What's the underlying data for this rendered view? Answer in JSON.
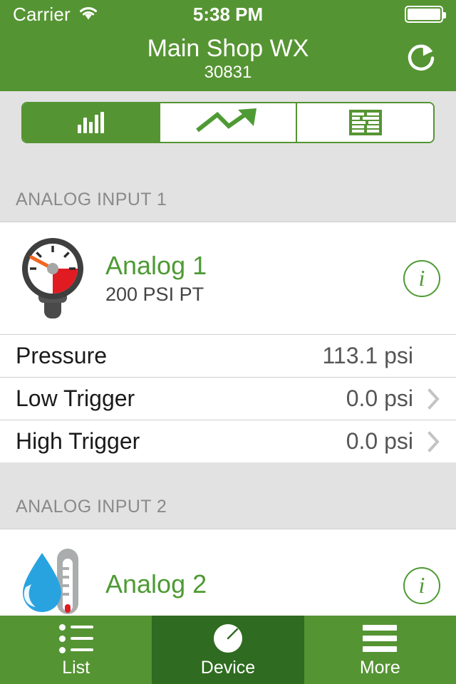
{
  "statusbar": {
    "carrier": "Carrier",
    "wifi_icon": "wifi-icon",
    "time": "5:38 PM",
    "battery_icon": "battery-full-icon"
  },
  "navbar": {
    "title": "Main Shop WX",
    "subtitle": "30831",
    "refresh_icon": "refresh-icon"
  },
  "segmented_control": {
    "segments": [
      {
        "name": "gauges",
        "icon": "bar-chart-icon",
        "selected": true
      },
      {
        "name": "trend",
        "icon": "trend-up-arrow-icon",
        "selected": false
      },
      {
        "name": "log",
        "icon": "table-list-icon",
        "selected": false
      }
    ]
  },
  "sections": [
    {
      "header": "ANALOG INPUT 1",
      "device": {
        "icon": "pressure-gauge-icon",
        "name": "Analog 1",
        "subtitle": "200 PSI PT",
        "info_icon": "info-circle-icon"
      },
      "rows": [
        {
          "label": "Pressure",
          "value": "113.1 psi",
          "chevron": false
        },
        {
          "label": "Low Trigger",
          "value": "0.0 psi",
          "chevron": true
        },
        {
          "label": "High Trigger",
          "value": "0.0 psi",
          "chevron": true
        }
      ]
    },
    {
      "header": "ANALOG INPUT 2",
      "device": {
        "icon": "humidity-temperature-icon",
        "name": "Analog 2",
        "subtitle": "",
        "info_icon": "info-circle-icon"
      },
      "rows": []
    }
  ],
  "tabbar": {
    "tabs": [
      {
        "label": "List",
        "icon": "bullet-list-icon",
        "active": false
      },
      {
        "label": "Device",
        "icon": "gauge-icon",
        "active": true
      },
      {
        "label": "More",
        "icon": "hamburger-menu-icon",
        "active": false
      }
    ]
  },
  "colors": {
    "brand_green": "#559433",
    "active_tab_green": "#2f6b20",
    "accent_text_green": "#4e9a34",
    "background_gray": "#e2e2e2",
    "gauge_red": "#e01b22",
    "needle_orange": "#f26722",
    "droplet_blue": "#29a3e0"
  }
}
